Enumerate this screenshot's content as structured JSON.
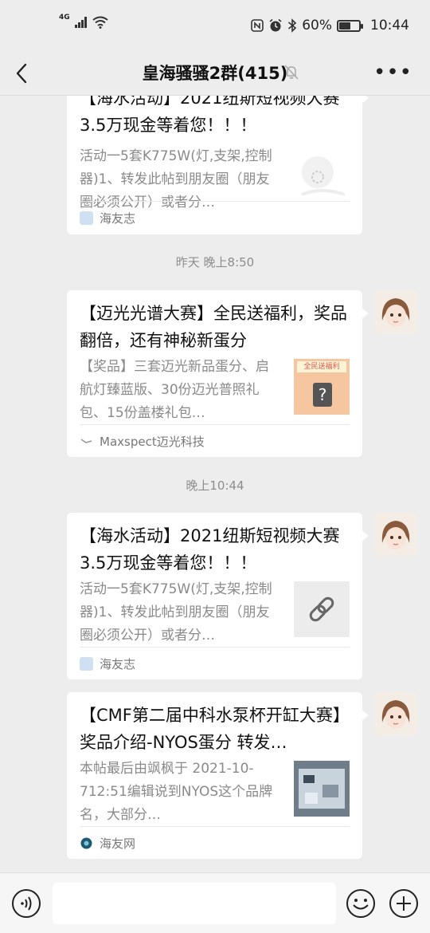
{
  "status_bar": {
    "network": "4G",
    "battery": "60%",
    "battery_level": 0.6,
    "time": "10:44"
  },
  "header": {
    "title": "皇海骚骚2群(415)"
  },
  "messages": [
    {
      "title": "【海水活动】2021纽斯短视频大赛 3.5万现金等着您！！！",
      "description": "活动一5套K775W(灯,支架,控制器)1、转发此帖到朋友圈（朋友圈必须公开）或者分…",
      "source": "海友志"
    },
    {
      "timestamp": "昨天 晚上8:50",
      "title": "【迈光光谱大赛】全民送福利，奖品翻倍，还有神秘新蛋分",
      "description": "【奖品】三套迈光新品蛋分、启航灯臻蓝版、30份迈光普照礼包、15份盖楼礼包…",
      "thumb_text": "全民送福利",
      "source": "Maxspect迈光科技"
    },
    {
      "timestamp": "晚上10:44",
      "title": "【海水活动】2021纽斯短视频大赛 3.5万现金等着您！！！",
      "description": "活动一5套K775W(灯,支架,控制器)1、转发此帖到朋友圈（朋友圈必须公开）或者分…",
      "thumb_icon": "link-icon",
      "source": "海友志"
    },
    {
      "title": "【CMF第二届中科水泵杯开缸大赛】奖品介绍-NYOS蛋分 转发…",
      "description": "本帖最后由飒枫于 2021-10-712:51编辑说到NYOS这个品牌名，大部分…",
      "source": "海友网"
    }
  ],
  "colors": {
    "background": "#ededed",
    "card": "#ffffff",
    "muted_text": "#8a8a8a"
  }
}
